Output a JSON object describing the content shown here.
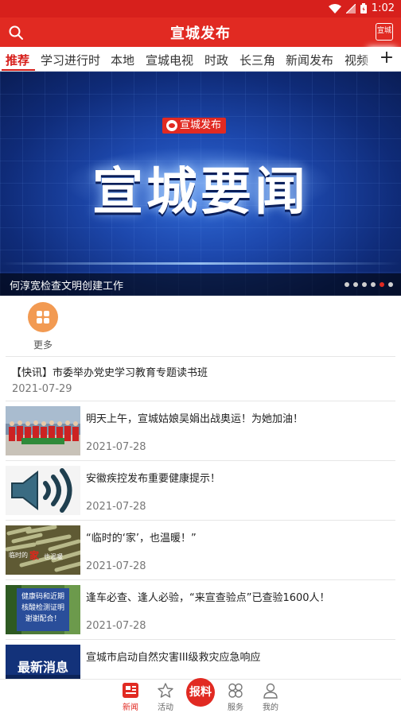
{
  "status_bar": {
    "time": "1:02"
  },
  "header": {
    "title": "宣城发布",
    "scan_label": "宣城"
  },
  "tabs": [
    "推荐",
    "学习进行时",
    "本地",
    "宣城电视",
    "时政",
    "长三角",
    "新闻发布",
    "视频"
  ],
  "active_tab": "推荐",
  "banner": {
    "logo_text": "宣城发布",
    "headline": "宣城要闻",
    "caption": "何淳宽检查文明创建工作",
    "dot_count": 6,
    "active_dot": 5
  },
  "quick_entry": {
    "label": "更多",
    "icon": "grid-icon"
  },
  "flash_news": {
    "title": "【快讯】市委举办党史学习教育专题读书班",
    "date": "2021-07-29"
  },
  "news": [
    {
      "title": "明天上午，宣城姑娘吴娟出战奥运！为她加油！",
      "date": "2021-07-28",
      "thumb": "team-photo"
    },
    {
      "title": "安徽疾控发布重要健康提示！",
      "date": "2021-07-28",
      "thumb": "speaker-icon"
    },
    {
      "title": "“临时的‘家’，也温暖！”",
      "date": "2021-07-28",
      "thumb": "sticks-photo"
    },
    {
      "title": "逢车必查、逢人必验，“来宣查验点”已查验1600人！",
      "date": "2021-07-28",
      "thumb": "checkpoint-sign"
    },
    {
      "title": "宣城市启动自然灾害III级救灾应急响应",
      "date": "",
      "thumb": "breaking-news"
    }
  ],
  "thumb_text": {
    "sticks": "临时的",
    "sticks_accent": "家",
    "sticks_tail": "也温暖",
    "checkpoint": [
      "健康码和近期",
      "核酸检测证明",
      "谢谢配合！"
    ],
    "breaking": "最新消息"
  },
  "bottom_nav": [
    {
      "label": "新闻",
      "icon": "news-icon"
    },
    {
      "label": "活动",
      "icon": "star-icon"
    },
    {
      "label": "服务",
      "icon": "services-icon"
    },
    {
      "label": "我的",
      "icon": "profile-icon"
    }
  ],
  "report_button": "报料",
  "colors": {
    "brand_red": "#e12a22",
    "status_red": "#d7201c",
    "more_orange": "#f29a52"
  }
}
